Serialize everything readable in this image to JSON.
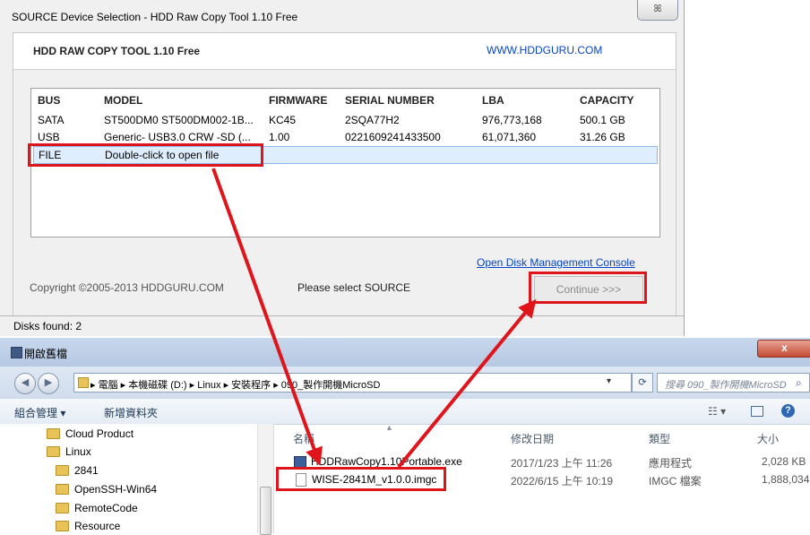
{
  "raw_window": {
    "title": "SOURCE Device Selection - HDD Raw Copy Tool 1.10   Free",
    "close_glyph": "ꕤ",
    "app_name": "HDD RAW COPY TOOL 1.10   Free",
    "url": "WWW.HDDGURU.COM",
    "columns": [
      "BUS",
      "MODEL",
      "FIRMWARE",
      "SERIAL NUMBER",
      "LBA",
      "CAPACITY"
    ],
    "rows": [
      {
        "bus": "SATA",
        "model": "ST500DM0 ST500DM002-1B...",
        "firmware": "KC45",
        "serial": "2SQA77H2",
        "lba": "976,773,168",
        "capacity": "500.1 GB"
      },
      {
        "bus": "USB",
        "model": "Generic- USB3.0 CRW   -SD (...",
        "firmware": "1.00",
        "serial": "0221609241433500",
        "lba": "61,071,360",
        "capacity": "31.26 GB"
      }
    ],
    "file_row": {
      "bus": "FILE",
      "model": "Double-click to open file"
    },
    "disk_mgmt_link": "Open Disk Management Console",
    "copyright": "Copyright ©2005-2013 HDDGURU.COM",
    "status": "Please select SOURCE",
    "continue_label": "Continue >>>",
    "disks_found": "Disks found: 2"
  },
  "open_dialog": {
    "title": "開啟舊檔",
    "close_glyph": "x",
    "address": "▸ 電腦 ▸ 本機磁碟 (D:) ▸ Linux ▸ 安裝程序 ▸ 090_製作開機MicroSD",
    "search_placeholder": "搜尋 090_製作開機MicroSD",
    "toolbar": {
      "organize": "組合管理 ▾",
      "new_folder": "新增資料夾"
    },
    "tree": [
      "Cloud Product",
      "Linux",
      "2841",
      "OpenSSH-Win64",
      "RemoteCode",
      "Resource"
    ],
    "file_columns": {
      "name": "名稱",
      "date": "修改日期",
      "type": "類型",
      "size": "大小"
    },
    "files": [
      {
        "name": "HDDRawCopy1.10Portable.exe",
        "date": "2017/1/23 上午 11:26",
        "type": "應用程式",
        "size": "2,028 KB"
      },
      {
        "name": "WISE-2841M_v1.0.0.imgc",
        "date": "2022/6/15 上午 10:19",
        "type": "IMGC 檔案",
        "size": "1,888,034..."
      }
    ]
  },
  "colors": {
    "annotation_red": "#e0141b",
    "link_blue": "#0645c8",
    "selection": "#dfeeff"
  }
}
